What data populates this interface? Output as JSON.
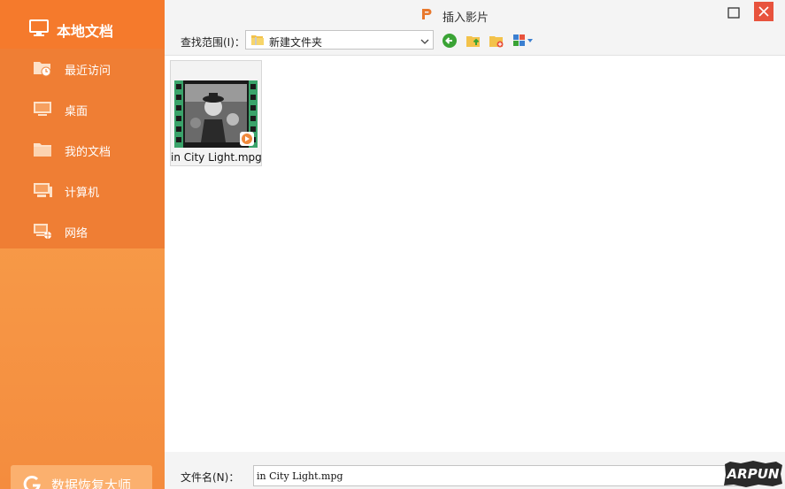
{
  "window": {
    "title": "插入影片"
  },
  "sidebar": {
    "header_title": "本地文档",
    "items": [
      {
        "label": "最近访问",
        "icon": "recent-folder-icon"
      },
      {
        "label": "桌面",
        "icon": "desktop-icon"
      },
      {
        "label": "我的文档",
        "icon": "folder-icon"
      },
      {
        "label": "计算机",
        "icon": "computer-icon"
      },
      {
        "label": "网络",
        "icon": "network-icon"
      }
    ],
    "recovery_label": "数据恢复大师"
  },
  "toolbar": {
    "look_in_label": "查找范围(I)：",
    "look_in_value": "新建文件夹",
    "buttons": [
      "back-icon",
      "up-folder-icon",
      "new-folder-icon",
      "view-menu-icon"
    ]
  },
  "files": [
    {
      "name": "in City Light.mpg",
      "type": "video"
    }
  ],
  "bottom": {
    "filename_label": "文件名(N)：",
    "filename_value": "in City Light.mpg"
  },
  "watermark": {
    "text": "ARPUN"
  },
  "colors": {
    "sidebar": "#f78a3c",
    "sidebar_nav": "#ef7e34",
    "close_button": "#e8533d",
    "back_button": "#3aa335"
  }
}
